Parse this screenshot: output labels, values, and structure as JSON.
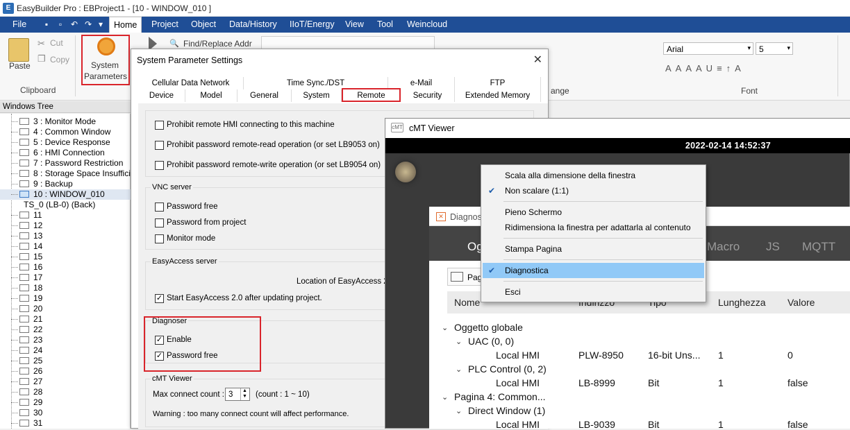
{
  "title_bar": {
    "text": "EasyBuilder Pro : EBProject1 - [10 - WINDOW_010 ]"
  },
  "menu": [
    "File",
    "Home",
    "Project",
    "Object",
    "Data/History",
    "IIoT/Energy",
    "View",
    "Tool",
    "Weincloud"
  ],
  "ribbon": {
    "paste": "Paste",
    "cut": "Cut",
    "copy": "Copy",
    "clipboard_group": "Clipboard",
    "system_parameters_line1": "System",
    "system_parameters_line2": "Parameters",
    "find_replace": "Find/Replace Addr",
    "font_name": "Arial",
    "font_size": "5",
    "font_group": "Font",
    "arrange_group": "ange"
  },
  "windows_tree": {
    "header": "Windows Tree",
    "items": [
      {
        "label": "3 : Monitor Mode",
        "indent": 1
      },
      {
        "label": "4 : Common Window",
        "indent": 1
      },
      {
        "label": "5 : Device Response",
        "indent": 1
      },
      {
        "label": "6 : HMI Connection",
        "indent": 1
      },
      {
        "label": "7 : Password Restriction",
        "indent": 1
      },
      {
        "label": "8 : Storage Space Insufficie",
        "indent": 1
      },
      {
        "label": "9 : Backup",
        "indent": 1
      },
      {
        "label": "10 : WINDOW_010",
        "indent": 1
      },
      {
        "label": "TS_0 (LB-0) (Back)",
        "indent": 2
      },
      {
        "label": "11",
        "indent": 1
      },
      {
        "label": "12",
        "indent": 1
      },
      {
        "label": "13",
        "indent": 1
      },
      {
        "label": "14",
        "indent": 1
      },
      {
        "label": "15",
        "indent": 1
      },
      {
        "label": "16",
        "indent": 1
      },
      {
        "label": "17",
        "indent": 1
      },
      {
        "label": "18",
        "indent": 1
      },
      {
        "label": "19",
        "indent": 1
      },
      {
        "label": "20",
        "indent": 1
      },
      {
        "label": "21",
        "indent": 1
      },
      {
        "label": "22",
        "indent": 1
      },
      {
        "label": "23",
        "indent": 1
      },
      {
        "label": "24",
        "indent": 1
      },
      {
        "label": "25",
        "indent": 1
      },
      {
        "label": "26",
        "indent": 1
      },
      {
        "label": "27",
        "indent": 1
      },
      {
        "label": "28",
        "indent": 1
      },
      {
        "label": "29",
        "indent": 1
      },
      {
        "label": "30",
        "indent": 1
      },
      {
        "label": "31",
        "indent": 1
      }
    ]
  },
  "sys_dialog": {
    "title": "System Parameter Settings",
    "tabs_row1": [
      "Cellular Data Network",
      "Time Sync./DST",
      "e-Mail",
      "FTP"
    ],
    "tabs_row2": [
      "Device",
      "Model",
      "General",
      "System",
      "Remote",
      "Security",
      "Extended Memory"
    ],
    "active_tab": "Remote",
    "remote_checks": [
      {
        "label": "Prohibit remote HMI connecting to this machine",
        "checked": false
      },
      {
        "label": "Prohibit password remote-read operation (or set LB9053 on)",
        "checked": false
      },
      {
        "label": "Prohibit password remote-write operation (or set LB9054 on)",
        "checked": false
      }
    ],
    "vnc": {
      "title": "VNC server",
      "checks": [
        {
          "label": "Password free",
          "checked": false
        },
        {
          "label": "Password from project",
          "checked": false
        },
        {
          "label": "Monitor mode",
          "checked": false
        }
      ]
    },
    "easyaccess": {
      "title": "EasyAccess server",
      "location": "Location of EasyAccess 2.",
      "start_check": "Start EasyAccess 2.0 after updating project."
    },
    "diagnoser": {
      "title": "Diagnoser",
      "enable": "Enable",
      "password_free": "Password free"
    },
    "cmt_viewer": {
      "title": "cMT Viewer",
      "max_label": "Max connect count :",
      "max_value": "3",
      "count_range": "(count : 1 ~ 10)",
      "warning": "Warning : too many connect count will affect performance."
    }
  },
  "cmt_viewer": {
    "title": "cMT Viewer",
    "datetime": "2022-02-14 14:52:37"
  },
  "diag_window": {
    "title": "Diagnos",
    "tabs": [
      "Ogg",
      "Macro",
      "JS",
      "MQTT"
    ],
    "tool_label": "Pagi",
    "columns": [
      "Nome",
      "Indirizzo",
      "Tipo",
      "Lunghezza",
      "Valore"
    ],
    "rows": [
      {
        "level": 0,
        "name": "Oggetto globale",
        "address": "",
        "type": "",
        "length": "",
        "value": ""
      },
      {
        "level": 1,
        "name": "UAC (0, 0)",
        "address": "",
        "type": "",
        "length": "",
        "value": ""
      },
      {
        "level": 2,
        "name": "Local HMI",
        "address": "PLW-8950",
        "type": "16-bit Uns...",
        "length": "1",
        "value": "0"
      },
      {
        "level": 1,
        "name": "PLC Control (0, 2)",
        "address": "",
        "type": "",
        "length": "",
        "value": ""
      },
      {
        "level": 2,
        "name": "Local HMI",
        "address": "LB-8999",
        "type": "Bit",
        "length": "1",
        "value": "false"
      },
      {
        "level": 0,
        "name": "Pagina 4: Common...",
        "address": "",
        "type": "",
        "length": "",
        "value": ""
      },
      {
        "level": 1,
        "name": "Direct Window (1)",
        "address": "",
        "type": "",
        "length": "",
        "value": ""
      },
      {
        "level": 2,
        "name": "Local HMI",
        "address": "LB-9039",
        "type": "Bit",
        "length": "1",
        "value": "false"
      }
    ]
  },
  "context_menu": {
    "items": [
      {
        "label": "Scala alla dimensione della finestra",
        "checked": false
      },
      {
        "label": "Non scalare (1:1)",
        "checked": true
      },
      {
        "label": "Pieno Schermo",
        "checked": false
      },
      {
        "label": "Ridimensiona la finestra per adattarla al contenuto",
        "checked": false
      },
      {
        "label": "Stampa Pagina",
        "checked": false
      },
      {
        "label": "Diagnostica",
        "checked": true,
        "highlighted": true
      },
      {
        "label": "Esci",
        "checked": false
      }
    ]
  },
  "colors": {
    "menu_bg": "#1f4e96",
    "highlight": "#91c9f7",
    "red_box": "#d9242b"
  }
}
